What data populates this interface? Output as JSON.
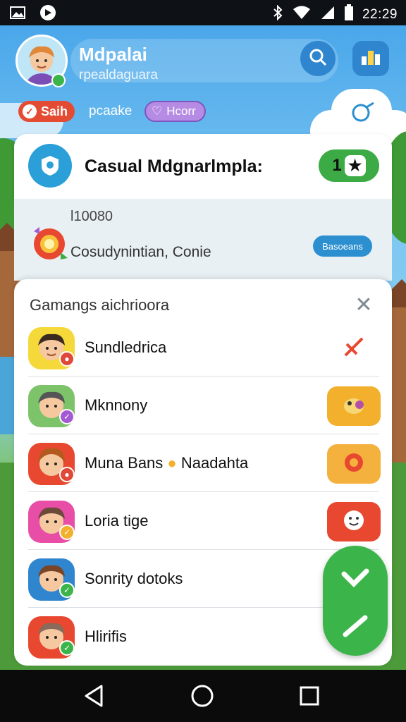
{
  "status_bar": {
    "time": "22:29"
  },
  "header": {
    "title": "Mdpalai",
    "subtitle": "rpealdaguara",
    "chip_primary": "Saih",
    "chip_text": "pcaake",
    "chip_secondary": "Hcorr"
  },
  "featured": {
    "title": "Casual Mdgnarlmpla:",
    "badge": "1"
  },
  "event": {
    "label": "l10080",
    "description": "Cosudynintian, Conie",
    "button": "Basoeans"
  },
  "sheet": {
    "title": "Gamangs aichrioora",
    "rows": [
      {
        "name": "Sundledrica",
        "badge_color": "#e0483a",
        "action_color": "#ffffff"
      },
      {
        "name": "Mknnony",
        "badge_color": "#a45ad2",
        "action_color": "#f2b02c"
      },
      {
        "name": "Muna Bans",
        "name_suffix": "Naadahta",
        "badge_color": "#e0483a",
        "action_color": "#f5b13d"
      },
      {
        "name": "Loria tige",
        "badge_color": "#f2b02c",
        "action_color": "#e8482f"
      },
      {
        "name": "Sonrity dotoks",
        "badge_color": "#3bb54a",
        "action_color": "#4aa5d8"
      },
      {
        "name": "Hlirifis",
        "badge_color": "#3bb54a",
        "action_color": "#ffffff"
      }
    ]
  },
  "colors": {
    "accent_green": "#3bb54a",
    "accent_blue": "#2f86cf",
    "sky": "#4a9fe0"
  }
}
